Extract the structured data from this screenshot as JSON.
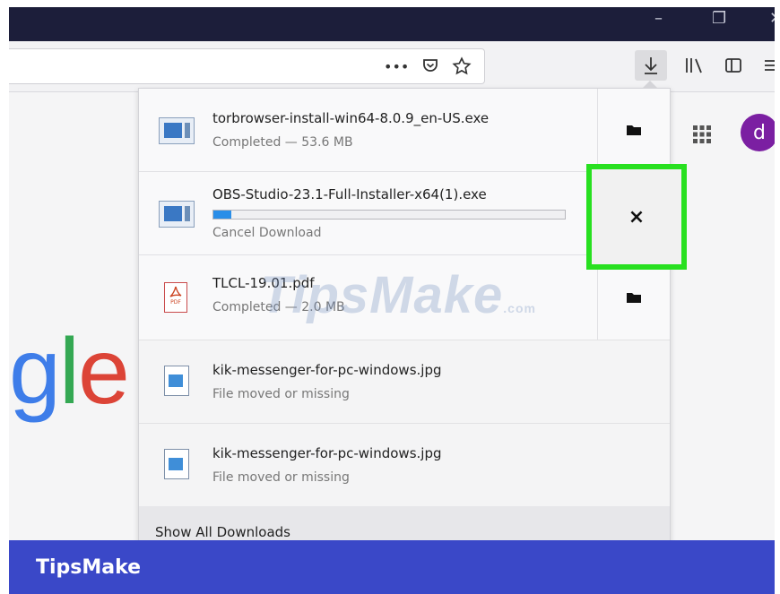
{
  "window": {
    "controls": [
      "–",
      "❐",
      "✕"
    ]
  },
  "toolbar": {
    "more_icon": "•••",
    "pocket_icon": "pocket-icon",
    "bookmark_icon": "star-icon",
    "downloads_icon": "download-arrow-icon",
    "library_icon": "library-icon",
    "sidebar_icon": "sidebar-icon",
    "menu_icon": "hamburger-icon"
  },
  "page": {
    "logo_partial": {
      "g": "g",
      "l": "l",
      "e": "e"
    },
    "avatar_letter": "d"
  },
  "downloads": {
    "items": [
      {
        "name": "torbrowser-install-win64-8.0.9_en-US.exe",
        "status": "Completed — 53.6 MB",
        "icon": "exe-file-icon",
        "action": "open-folder-icon"
      },
      {
        "name": "OBS-Studio-23.1-Full-Installer-x64(1).exe",
        "status": "Cancel Download",
        "icon": "exe-file-icon",
        "action": "cancel-icon",
        "progress": 0.05
      },
      {
        "name": "TLCL-19.01.pdf",
        "status": "Completed — 2.0 MB",
        "icon": "pdf-file-icon",
        "action": "open-folder-icon"
      },
      {
        "name": "kik-messenger-for-pc-windows.jpg",
        "status": "File moved or missing",
        "icon": "image-file-icon"
      },
      {
        "name": "kik-messenger-for-pc-windows.jpg",
        "status": "File moved or missing",
        "icon": "image-file-icon"
      }
    ],
    "show_all": "Show All Downloads"
  },
  "highlight": {
    "symbol": "×",
    "color": "#28e020"
  },
  "watermark": {
    "text": "TipsMake",
    "suffix": ".com"
  },
  "footer": {
    "brand": "TipsMake"
  },
  "colors": {
    "titlebar": "#1c1e3a",
    "footer": "#3a48c8",
    "progress": "#2a8ee8",
    "avatar": "#7b1fa2"
  }
}
